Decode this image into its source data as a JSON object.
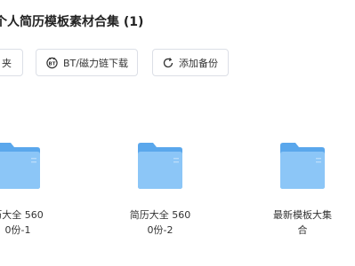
{
  "header": {
    "title": "个人简历模板素材合集 (1)"
  },
  "toolbar": {
    "folder_label": "夹",
    "bt_label": "BT/磁力链下载",
    "backup_label": "添加备份"
  },
  "items": [
    {
      "line1": "历大全 560",
      "line2": "0份-1"
    },
    {
      "line1": "简历大全 560",
      "line2": "0份-2"
    },
    {
      "line1": "最新模板大集",
      "line2": "合"
    }
  ],
  "colors": {
    "folder_back": "#5aa7ec",
    "folder_front": "#8cc6f7",
    "border": "#dcdfe6"
  }
}
